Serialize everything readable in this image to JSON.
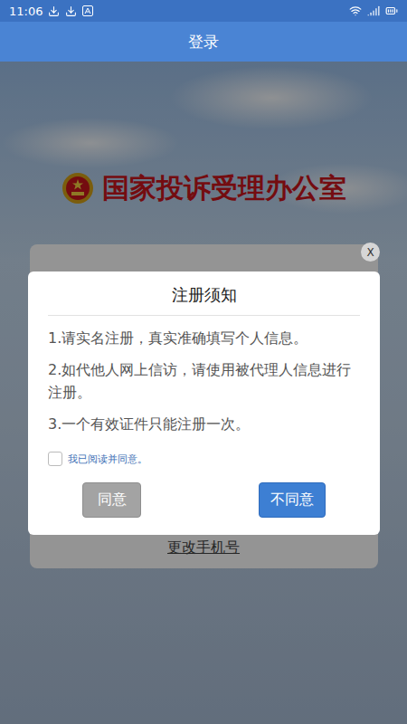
{
  "status_bar": {
    "time": "11:06"
  },
  "header": {
    "title": "登录"
  },
  "logo": {
    "text": "国家投诉受理办公室"
  },
  "card": {
    "link": "更改手机号"
  },
  "dialog": {
    "close": "X",
    "title": "注册须知",
    "items": [
      "1.请实名注册，真实准确填写个人信息。",
      "2.如代他人网上信访，请使用被代理人信息进行注册。",
      "3.一个有效证件只能注册一次。"
    ],
    "checkbox": {
      "label": "我已阅读并同意。",
      "checked": false
    },
    "buttons": [
      {
        "label": "同意",
        "disabled": true
      },
      {
        "label": "不同意",
        "disabled": false
      }
    ]
  }
}
